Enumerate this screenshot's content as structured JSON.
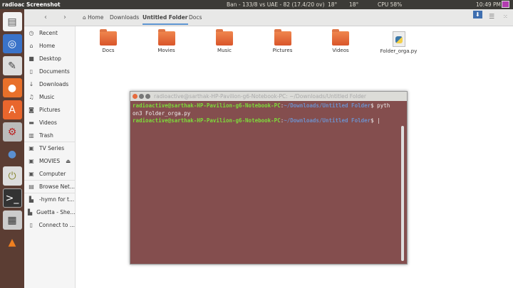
{
  "topbar": {
    "app_title": "radioac Screenshot",
    "cricket": "Ban - 133/8 vs UAE - 82 (17.4/20 ov)",
    "weather1": "18°",
    "weather2": "18°",
    "cpu": "CPU 58%",
    "clock": "10:49 PM"
  },
  "header": {
    "back": "‹",
    "forward": "›",
    "breadcrumbs": [
      "Home",
      "Downloads",
      "Untitled Folder",
      "Docs"
    ],
    "active_crumb": "Untitled Folder"
  },
  "sidebar": {
    "items": [
      {
        "icon": "◷",
        "label": "Recent"
      },
      {
        "icon": "⌂",
        "label": "Home"
      },
      {
        "icon": "■",
        "label": "Desktop"
      },
      {
        "icon": "▯",
        "label": "Documents"
      },
      {
        "icon": "↓",
        "label": "Downloads"
      },
      {
        "icon": "♫",
        "label": "Music"
      },
      {
        "icon": "◙",
        "label": "Pictures"
      },
      {
        "icon": "▬",
        "label": "Videos"
      },
      {
        "icon": "▥",
        "label": "Trash"
      },
      {
        "icon": "▣",
        "label": "TV Series"
      },
      {
        "icon": "▣",
        "label": "MOVIES"
      },
      {
        "icon": "▣",
        "label": "Computer"
      },
      {
        "icon": "▤",
        "label": "Browse Net..."
      },
      {
        "icon": "▙",
        "label": "-hymn for t..."
      },
      {
        "icon": "▙",
        "label": "Guetta - She..."
      },
      {
        "icon": "▯",
        "label": "Connect to ..."
      }
    ]
  },
  "files": [
    {
      "name": "Docs",
      "type": "folder"
    },
    {
      "name": "Movies",
      "type": "folder"
    },
    {
      "name": "Music",
      "type": "folder"
    },
    {
      "name": "Pictures",
      "type": "folder"
    },
    {
      "name": "Videos",
      "type": "folder"
    },
    {
      "name": "Folder_orga.py",
      "type": "python"
    }
  ],
  "terminal": {
    "title": "radioactive@sarthak-HP-Pavilion-g6-Notebook-PC: ~/Downloads/Untitled Folder",
    "user": "radioactive@sarthak-HP-Pavilion-g6-Notebook-PC",
    "path": "~/Downloads/Untitled Folder",
    "cmd1a": "$ pyth",
    "cmd1b": "on3 Folder_orga.py",
    "prompt2": "$ |",
    "colon": ":"
  }
}
